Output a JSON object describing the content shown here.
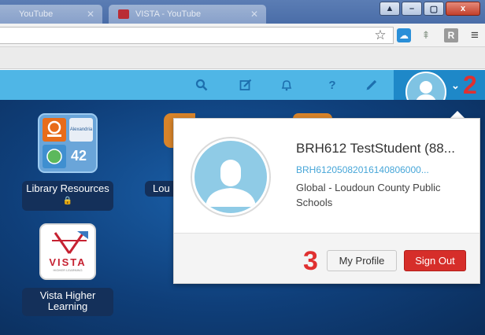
{
  "browser": {
    "tabs": [
      {
        "label": "YouTube"
      },
      {
        "label": "VISTA - YouTube"
      }
    ],
    "window_controls": {
      "user": "▲",
      "minimize": "–",
      "maximize": "▢",
      "close": "x"
    }
  },
  "header": {
    "icons": [
      "search-icon",
      "edit-icon",
      "bell-icon",
      "help-icon",
      "pencil-icon"
    ],
    "help_glyph": "?",
    "marker": "2",
    "accent": "#4fb6e6",
    "profile_tab_color": "#1e88c8"
  },
  "desktop": {
    "tiles": [
      {
        "caption": "Library Resources",
        "count": "42",
        "sub_logo_text": "Alexandria"
      },
      {
        "caption": "Vista Higher Learning",
        "logo_word": "VISTA",
        "logo_sub": "HIGHER LEARNING"
      },
      {
        "caption": "Lou"
      }
    ]
  },
  "profile_popover": {
    "name": "BRH612 TestStudent (88...",
    "id": "BRH61205082016140806000...",
    "org": "Global - Loudoun County Public Schools",
    "my_profile_label": "My Profile",
    "sign_out_label": "Sign Out",
    "marker": "3",
    "sign_out_color": "#d62e2a"
  }
}
